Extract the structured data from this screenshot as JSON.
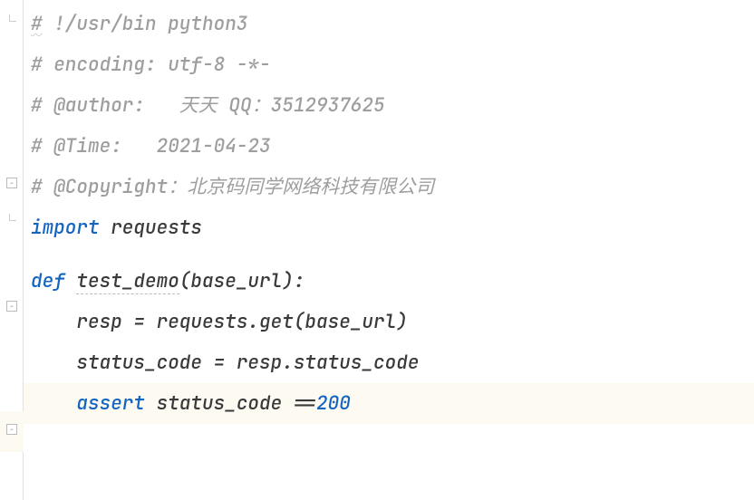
{
  "code": {
    "l1_a": "#",
    "l1_b": " !/usr/bin python3",
    "l2": "# encoding: utf-8 -*-",
    "l3": "# @author:   天天 QQ：3512937625",
    "l4": "# @Time:   2021-04-23",
    "l5": "# @Copyright：北京码同学网络科技有限公司",
    "l6_import": "import",
    "l6_pkg": " requests",
    "l7_def": "def",
    "l7_name": "test_demo",
    "l7_params": "(base_url):",
    "l8_a": "    resp ",
    "l8_b": "=",
    "l8_c": " requests.get(base_url)",
    "l9_a": "    status_code ",
    "l9_b": "=",
    "l9_c": " resp.status_code",
    "l10_indent": "    ",
    "l10_kw": "assert",
    "l10_a": " status_code ",
    "l10_b": "==",
    "l10_num": "200"
  }
}
